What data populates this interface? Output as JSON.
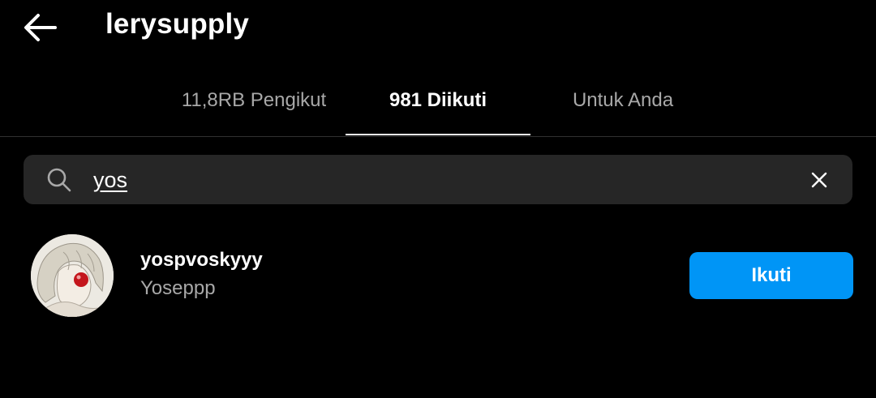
{
  "header": {
    "title": "lerysupply",
    "back_icon": "arrow-left-icon"
  },
  "tabs": [
    {
      "label": "11,8RB Pengikut",
      "active": false
    },
    {
      "label": "981 Diikuti",
      "active": true
    },
    {
      "label": "Untuk Anda",
      "active": false
    }
  ],
  "search": {
    "value": "yos",
    "icon": "search-icon",
    "clear_icon": "close-icon"
  },
  "results": [
    {
      "username": "yospvoskyyy",
      "full_name": "Yoseppp",
      "button_label": "Ikuti"
    }
  ],
  "colors": {
    "background": "#000000",
    "secondary_text": "#a8a8a8",
    "search_bg": "#262626",
    "follow_button": "#0095f6"
  }
}
